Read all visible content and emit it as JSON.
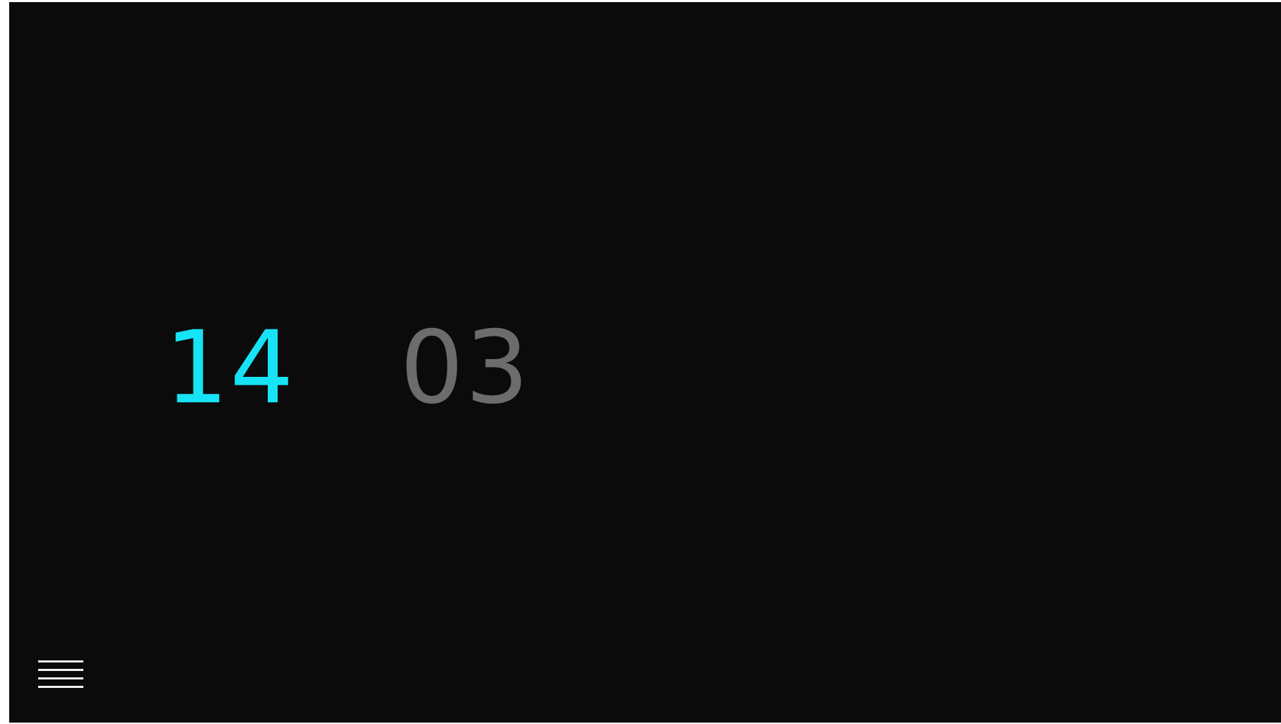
{
  "clock": {
    "hours": "14",
    "minutes": "03"
  },
  "colors": {
    "background": "#0b0b0b",
    "hours_color": "#16e4f6",
    "minutes_color": "#6c6c6c",
    "menu_icon_color": "#f2f2f2"
  },
  "icons": {
    "menu": "hamburger-menu-icon"
  }
}
